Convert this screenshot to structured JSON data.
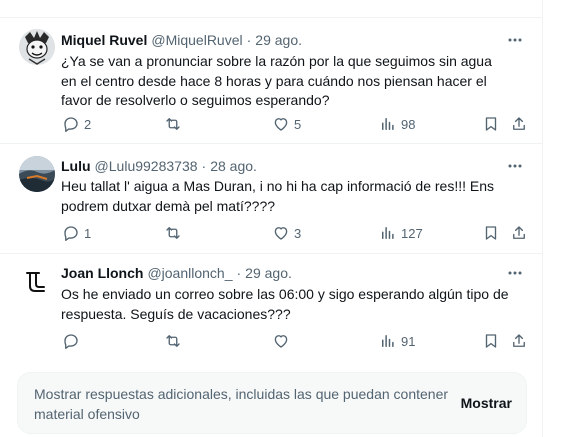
{
  "replies": [
    {
      "avatar": "cartoon-face-avatar",
      "name": "Miquel Ruvel",
      "handle": "@MiquelRuvel",
      "separator": "·",
      "date": "29 ago.",
      "text": "¿Ya se van a pronunciar sobre la razón por la que seguimos sin agua en el centro desde hace 8 horas y para cuándo nos piensan hacer el favor de resolverlo o seguimos esperando?",
      "replies_count": "2",
      "reposts_count": "",
      "likes_count": "5",
      "views_count": "98"
    },
    {
      "avatar": "landscape-photo-avatar",
      "name": "Lulu",
      "handle": "@Lulu99283738",
      "separator": "·",
      "date": "28 ago.",
      "text": "Heu tallat l' aigua a Mas Duran, i no hi ha cap informació de res!!! Ens podrem dutxar demà pel matí????",
      "replies_count": "1",
      "reposts_count": "",
      "likes_count": "3",
      "views_count": "127"
    },
    {
      "avatar": "logo-avatar",
      "name": "Joan Llonch",
      "handle": "@joanllonch_",
      "separator": "·",
      "date": "29 ago.",
      "text": "Os he enviado un correo sobre las 06:00 y sigo esperando algún tipo de respuesta. Seguís de vacaciones???",
      "replies_count": "",
      "reposts_count": "",
      "likes_count": "",
      "views_count": "91"
    }
  ],
  "more_replies": {
    "text": "Mostrar respuestas adicionales, incluidas las que puedan contener material ofensivo",
    "button": "Mostrar"
  },
  "colors": {
    "text_primary": "#0f1419",
    "text_secondary": "#536471",
    "divider": "#eff3f4",
    "panel_bg": "#f7f9f9"
  }
}
